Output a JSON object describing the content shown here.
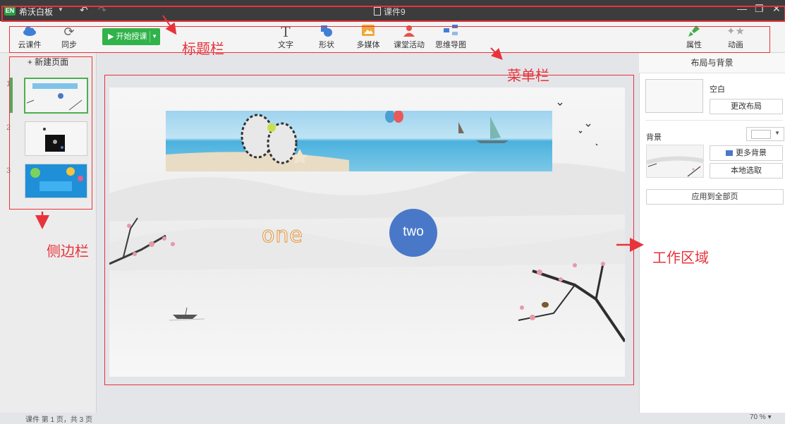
{
  "titlebar": {
    "logo": "EN",
    "app_name": "希沃白板",
    "doc_title": "课件9",
    "icons": [
      "undo-icon",
      "redo-icon",
      "minimize-icon",
      "restore-icon",
      "close-icon"
    ]
  },
  "toolbar": {
    "cloud": "云课件",
    "sync": "同步",
    "start": "开始授课",
    "text": "文字",
    "shape": "形状",
    "media": "多媒体",
    "activity": "课堂活动",
    "mindmap": "思维导图",
    "properties": "属性",
    "animation": "动画"
  },
  "sidebar": {
    "new_page": "+ 新建页面",
    "pages": [
      {
        "num": "1",
        "selected": true
      },
      {
        "num": "2",
        "selected": false
      },
      {
        "num": "3",
        "selected": false
      }
    ]
  },
  "canvas": {
    "word_one": "one",
    "word_two": "two"
  },
  "right_panel": {
    "title": "布局与背景",
    "layout_name": "空白",
    "change_layout": "更改布局",
    "background_label": "背景",
    "more_backgrounds": "更多背景",
    "local_pick": "本地选取",
    "apply_all": "应用到全部页"
  },
  "status": {
    "page_info": "课件 第 1 页，共 3 页",
    "zoom": "70 % ▾"
  },
  "annotations": {
    "title_bar": "标题栏",
    "menu_bar": "菜单栏",
    "sidebar": "侧边栏",
    "work_area": "工作区域"
  },
  "colors": {
    "accent_green": "#2fb34a",
    "annotation_red": "#e8333a",
    "circle_blue": "#4a78c8"
  }
}
